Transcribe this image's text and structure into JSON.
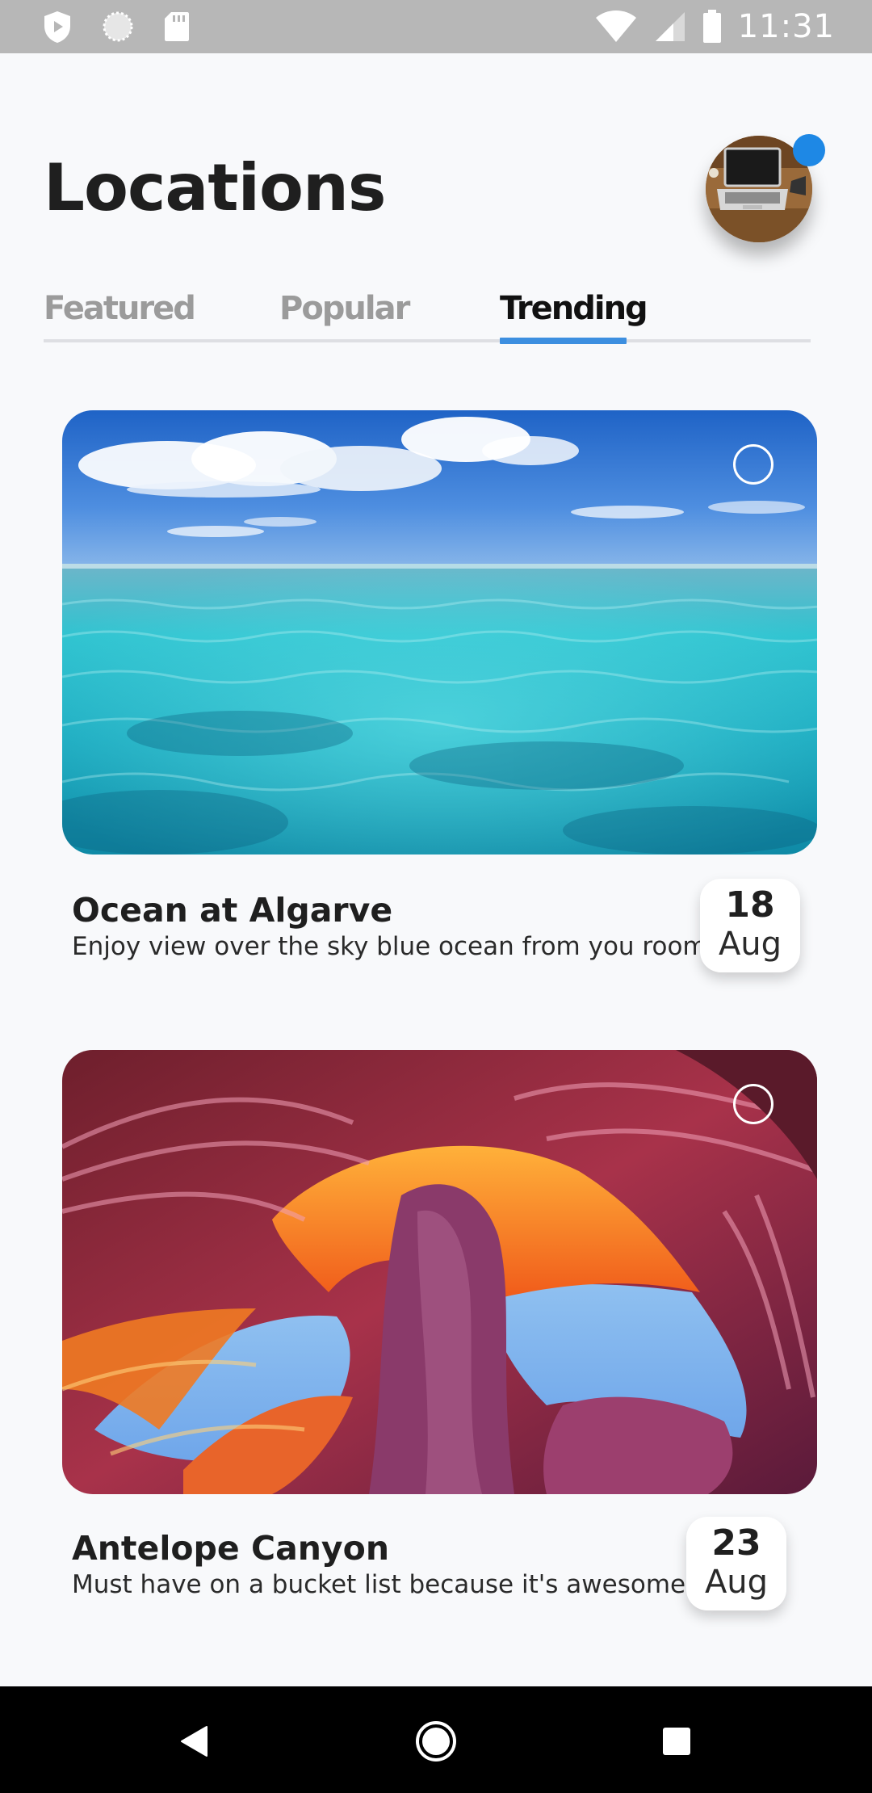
{
  "status_bar": {
    "time": "11:31",
    "left_icons": [
      "play-protect-icon",
      "sync-icon",
      "sd-card-icon"
    ],
    "right_icons": [
      "wifi-icon",
      "signal-icon",
      "battery-icon"
    ]
  },
  "header": {
    "title": "Locations",
    "avatar": "avatar-image",
    "notification_color": "#1e88e5"
  },
  "tabs": [
    {
      "label": "Featured",
      "active": false
    },
    {
      "label": "Popular",
      "active": false
    },
    {
      "label": "Trending",
      "active": true
    }
  ],
  "accent_color": "#3d8fe0",
  "cards": [
    {
      "title": "Ocean at Algarve",
      "subtitle": "Enjoy view over the sky blue ocean from you room",
      "day": "18",
      "month": "Aug",
      "image": "ocean-image"
    },
    {
      "title": "Antelope Canyon",
      "subtitle": "Must have on a bucket list because it's awesome",
      "day": "23",
      "month": "Aug",
      "image": "canyon-image"
    }
  ],
  "nav_bar": {
    "buttons": [
      "back-icon",
      "home-icon",
      "recents-icon"
    ]
  }
}
